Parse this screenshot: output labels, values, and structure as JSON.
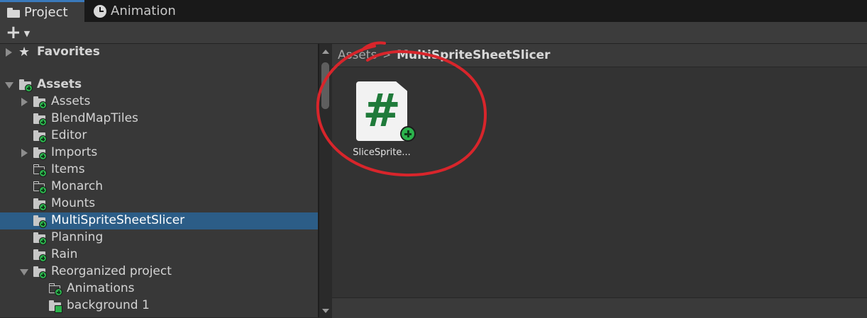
{
  "tabs": [
    {
      "label": "Project",
      "icon": "folder-icon",
      "active": true
    },
    {
      "label": "Animation",
      "icon": "clock-icon",
      "active": false
    }
  ],
  "toolbar": {
    "add_icon": "plus-icon",
    "dropdown_icon": "caret-down-icon"
  },
  "tree": {
    "favorites": {
      "label": "Favorites",
      "icon": "star-icon"
    },
    "root": {
      "label": "Assets"
    },
    "items": [
      {
        "label": "Assets",
        "expandable": true,
        "folder": "filled"
      },
      {
        "label": "BlendMapTiles",
        "expandable": false,
        "folder": "filled"
      },
      {
        "label": "Editor",
        "expandable": false,
        "folder": "filled"
      },
      {
        "label": "Imports",
        "expandable": true,
        "folder": "filled"
      },
      {
        "label": "Items",
        "expandable": false,
        "folder": "empty"
      },
      {
        "label": "Monarch",
        "expandable": false,
        "folder": "empty"
      },
      {
        "label": "Mounts",
        "expandable": false,
        "folder": "filled"
      },
      {
        "label": "MultiSpriteSheetSlicer",
        "expandable": false,
        "folder": "filled",
        "selected": true
      },
      {
        "label": "Planning",
        "expandable": false,
        "folder": "filled"
      },
      {
        "label": "Rain",
        "expandable": false,
        "folder": "filled"
      },
      {
        "label": "Reorganized project",
        "expandable": true,
        "expanded": true,
        "folder": "filled"
      }
    ],
    "sub_items": [
      {
        "label": "Animations",
        "folder": "empty"
      },
      {
        "label": "background 1",
        "folder": "filled"
      }
    ]
  },
  "breadcrumb": {
    "root": "Assets",
    "separator": ">",
    "current": "MultiSpriteSheetSlicer"
  },
  "asset": {
    "label": "SliceSprite...",
    "glyph": "#",
    "icon": "csharp-script-icon"
  },
  "colors": {
    "selection": "#2c5d87",
    "badge_green": "#2bb24c",
    "annotation_red": "#d8252b",
    "script_green": "#1f7a3a"
  }
}
